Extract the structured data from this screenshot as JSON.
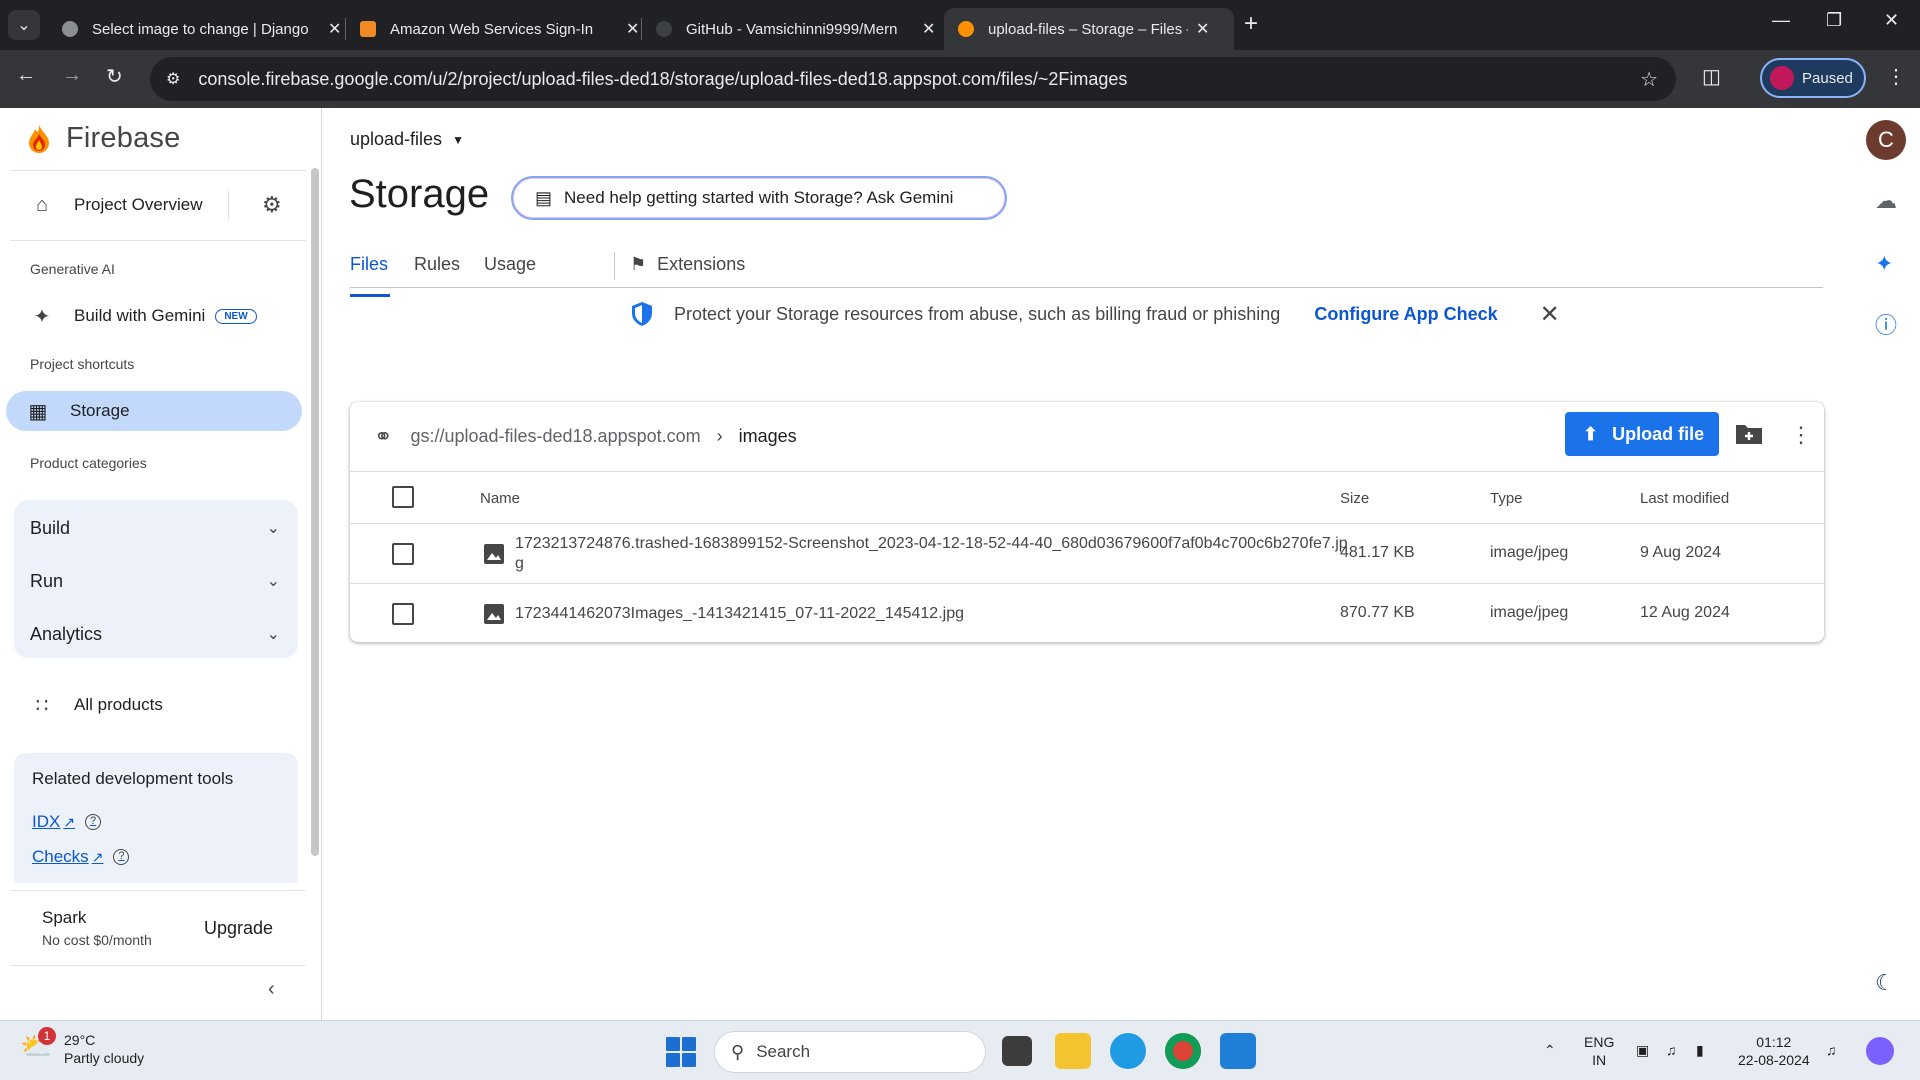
{
  "browser": {
    "tabs": [
      {
        "title": "Select image to change | Django",
        "fav_color": "#8a8d91"
      },
      {
        "title": "Amazon Web Services Sign-In",
        "fav_color": "#f28b25"
      },
      {
        "title": "GitHub - Vamsichinni9999/Mern",
        "fav_color": "#3c4043"
      },
      {
        "title": "upload-files – Storage – Files – Fi",
        "fav_color": "#ff9100"
      }
    ],
    "url": "console.firebase.google.com/u/2/project/upload-files-ded18/storage/upload-files-ded18.appspot.com/files/~2Fimages",
    "profile_label": "Paused"
  },
  "sidebar": {
    "brand": "Firebase",
    "project_overview": "Project Overview",
    "section_generative_ai": "Generative AI",
    "build_with_gemini": "Build with Gemini",
    "new_badge": "NEW",
    "section_shortcuts": "Project shortcuts",
    "storage": "Storage",
    "section_categories": "Product categories",
    "categories": [
      "Build",
      "Run",
      "Analytics"
    ],
    "all_products": "All products",
    "related_title": "Related development tools",
    "related_links": [
      "IDX",
      "Checks"
    ],
    "plan_name": "Spark",
    "plan_desc": "No cost $0/month",
    "upgrade": "Upgrade"
  },
  "main": {
    "project_name": "upload-files",
    "page_title": "Storage",
    "gemini_prompt": "Need help getting started with Storage? Ask Gemini",
    "tabs": [
      "Files",
      "Rules",
      "Usage",
      "Extensions"
    ],
    "banner_text": "Protect your Storage resources from abuse, such as billing fraud or phishing",
    "banner_link": "Configure App Check",
    "bucket": "gs://upload-files-ded18.appspot.com",
    "folder": "images",
    "upload_label": "Upload file",
    "columns": [
      "Name",
      "Size",
      "Type",
      "Last modified"
    ],
    "files": [
      {
        "name": "1723213724876.trashed-1683899152-Screenshot_2023-04-12-18-52-44-40_680d03679600f7af0b4c700c6b270fe7.jpg",
        "size": "481.17 KB",
        "type": "image/jpeg",
        "modified": "9 Aug 2024"
      },
      {
        "name": "1723441462073Images_-1413421415_07-11-2022_145412.jpg",
        "size": "870.77 KB",
        "type": "image/jpeg",
        "modified": "12 Aug 2024"
      }
    ]
  },
  "rail": {
    "avatar_letter": "C"
  },
  "taskbar": {
    "weather_badge": "1",
    "temperature": "29°C",
    "weather": "Partly cloudy",
    "search_placeholder": "Search",
    "lang_top": "ENG",
    "lang_bottom": "IN",
    "time": "01:12",
    "date": "22-08-2024"
  },
  "colors": {
    "accent": "#0b57d0",
    "upload_button": "#1a73e8",
    "active_nav": "#c2d9fc"
  }
}
